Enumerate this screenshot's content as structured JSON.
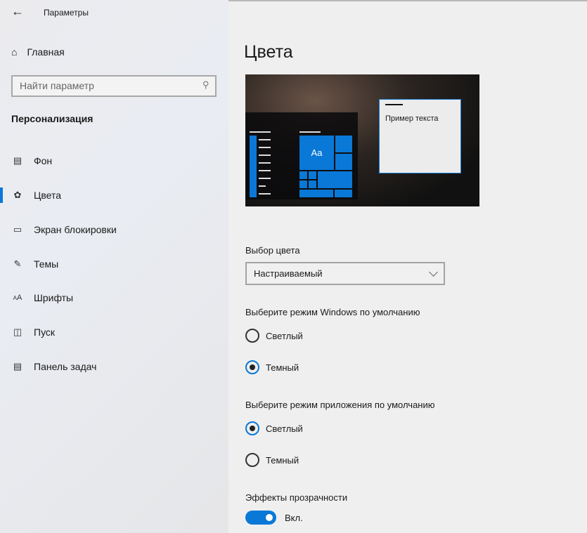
{
  "app": {
    "title": "Параметры",
    "back_icon": "arrow-left-icon"
  },
  "sidebar": {
    "home": "Главная",
    "search_placeholder": "Найти параметр",
    "section": "Персонализация",
    "items": [
      {
        "label": "Фон",
        "icon": "picture-icon"
      },
      {
        "label": "Цвета",
        "icon": "palette-icon",
        "selected": true
      },
      {
        "label": "Экран блокировки",
        "icon": "lock-screen-icon"
      },
      {
        "label": "Темы",
        "icon": "themes-icon"
      },
      {
        "label": "Шрифты",
        "icon": "fonts-icon"
      },
      {
        "label": "Пуск",
        "icon": "start-icon"
      },
      {
        "label": "Панель задач",
        "icon": "taskbar-icon"
      }
    ]
  },
  "main": {
    "title": "Цвета",
    "preview": {
      "sample_text": "Пример текста",
      "tile_text": "Aa"
    },
    "color_choice": {
      "label": "Выбор цвета",
      "value": "Настраиваемый"
    },
    "windows_mode": {
      "label": "Выберите режим Windows по умолчанию",
      "options": [
        "Светлый",
        "Темный"
      ],
      "selected": "Темный"
    },
    "app_mode": {
      "label": "Выберите режим приложения по умолчанию",
      "options": [
        "Светлый",
        "Темный"
      ],
      "selected": "Светлый"
    },
    "transparency": {
      "label": "Эффекты прозрачности",
      "state": "Вкл.",
      "on": true
    }
  },
  "colors": {
    "accent": "#0a78d7"
  }
}
